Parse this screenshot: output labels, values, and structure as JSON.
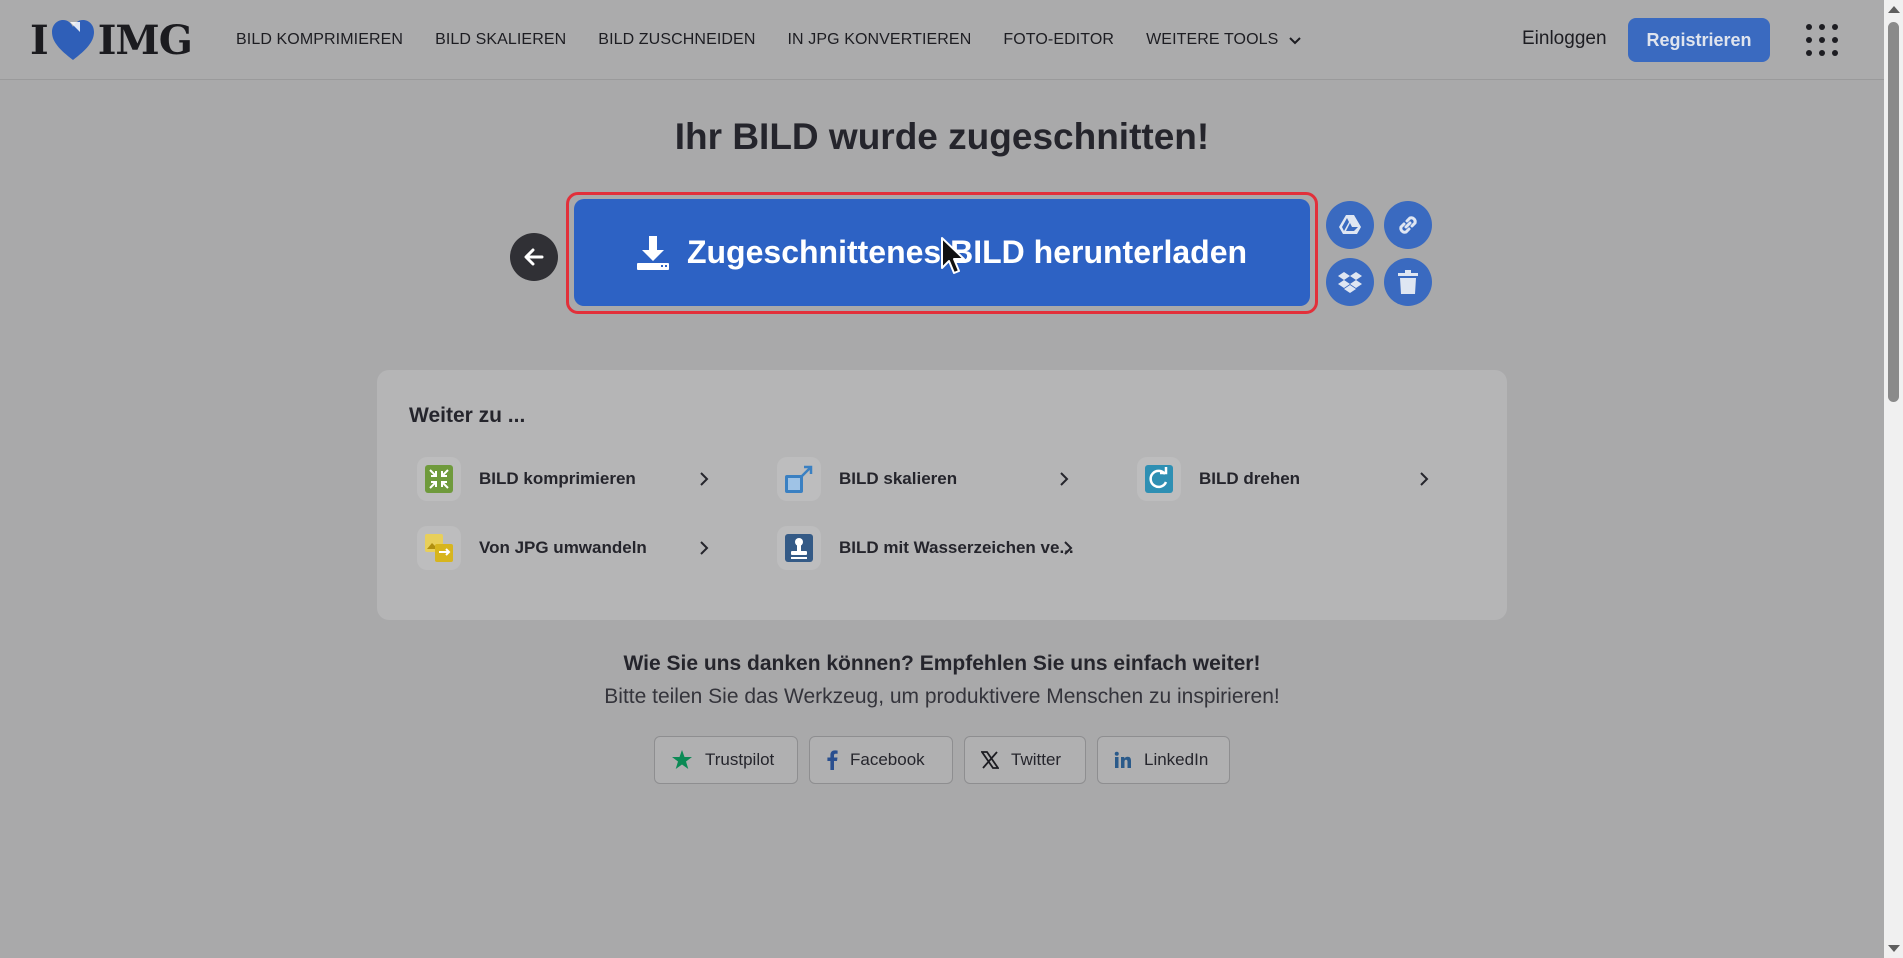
{
  "header": {
    "logo": {
      "prefix": "I",
      "suffix": "IMG",
      "heart_color": "#2f5fb8"
    },
    "nav": [
      {
        "label": "BILD KOMPRIMIEREN"
      },
      {
        "label": "BILD SKALIEREN"
      },
      {
        "label": "BILD ZUSCHNEIDEN"
      },
      {
        "label": "IN JPG KONVERTIEREN"
      },
      {
        "label": "FOTO-EDITOR"
      },
      {
        "label": "WEITERE TOOLS"
      }
    ],
    "login": "Einloggen",
    "register": "Registrieren"
  },
  "main": {
    "title": "Ihr BILD wurde zugeschnitten!",
    "download_label": "Zugeschnittenes BILD herunterladen",
    "accent": "#2d62c4",
    "highlight": "#e2303a"
  },
  "continue": {
    "title": "Weiter zu ...",
    "tools": [
      {
        "label": "BILD komprimieren",
        "icon": "compress-icon",
        "color": "#6f9a3c"
      },
      {
        "label": "BILD skalieren",
        "icon": "resize-icon",
        "color": "#3a80c2"
      },
      {
        "label": "BILD drehen",
        "icon": "rotate-icon",
        "color": "#2e8fb3"
      },
      {
        "label": "Von JPG umwandeln",
        "icon": "convert-from-jpg-icon",
        "color": "#d7b51e"
      },
      {
        "label": "BILD mit Wasserzeichen ve...",
        "icon": "watermark-icon",
        "color": "#345a86"
      }
    ]
  },
  "share": {
    "thanks": "Wie Sie uns danken können? Empfehlen Sie uns einfach weiter!",
    "sub": "Bitte teilen Sie das Werkzeug, um produktivere Menschen zu inspirieren!",
    "buttons": [
      {
        "label": "Trustpilot",
        "icon": "trustpilot-star-icon"
      },
      {
        "label": "Facebook",
        "icon": "facebook-icon"
      },
      {
        "label": "Twitter",
        "icon": "x-twitter-icon"
      },
      {
        "label": "LinkedIn",
        "icon": "linkedin-icon"
      }
    ]
  }
}
